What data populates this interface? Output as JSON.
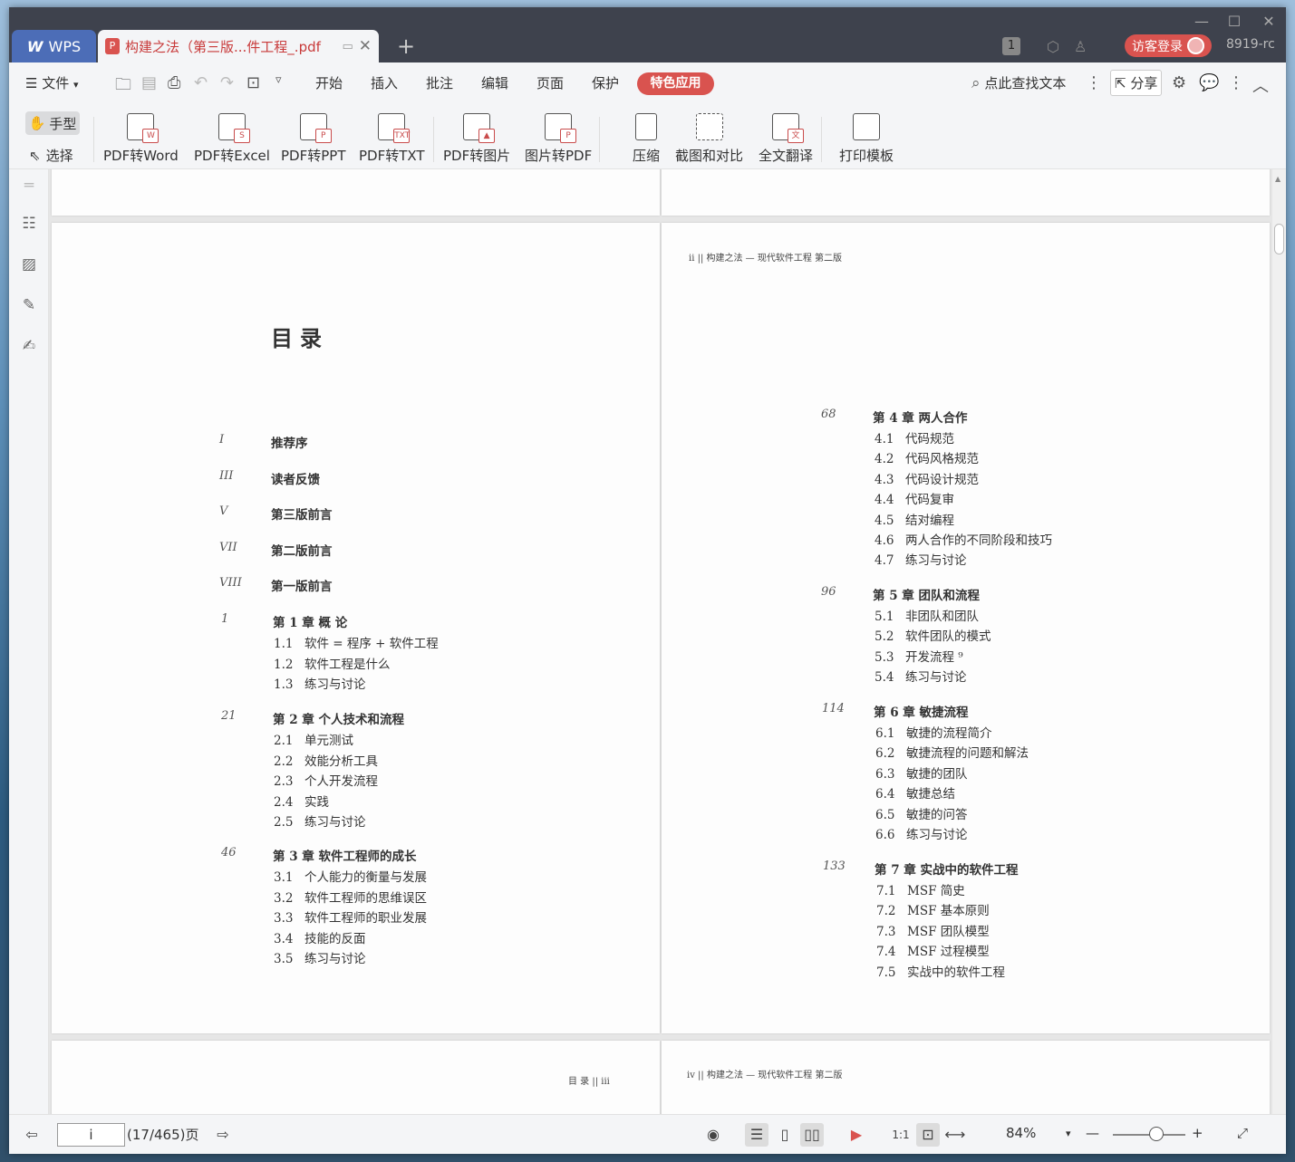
{
  "window": {
    "wps_tab": "WPS",
    "doc_tab": "构建之法（第三版...件工程_.pdf",
    "badge": "1",
    "login": "访客登录",
    "user_id": "8919-rc"
  },
  "menu": {
    "file": "文件",
    "items": [
      "开始",
      "插入",
      "批注",
      "编辑",
      "页面",
      "保护"
    ],
    "special": "特色应用",
    "search": "点此查找文本",
    "share": "分享"
  },
  "ribbon": {
    "hand": "手型",
    "select": "选择",
    "tools": [
      "PDF转Word",
      "PDF转Excel",
      "PDF转PPT",
      "PDF转TXT",
      "PDF转图片",
      "图片转PDF",
      "压缩",
      "截图和对比",
      "全文翻译",
      "打印模板"
    ]
  },
  "pages": {
    "right_header": "ii   ||     构建之法 — 现代软件工程   第二版",
    "left_title": "目录",
    "bottom_left_footer": "目   录      ||   iii",
    "bottom_right_header": "iv   ||     构建之法 — 现代软件工程   第二版",
    "left_front": [
      {
        "p": "I",
        "t": "推荐序"
      },
      {
        "p": "III",
        "t": "读者反馈"
      },
      {
        "p": "V",
        "t": "第三版前言"
      },
      {
        "p": "VII",
        "t": "第二版前言"
      },
      {
        "p": "VIII",
        "t": "第一版前言"
      }
    ],
    "left_chapters": [
      {
        "p": "1",
        "t": "第 1 章    概  论",
        "subs": [
          [
            "1.1",
            "软件 = 程序 + 软件工程"
          ],
          [
            "1.2",
            "软件工程是什么"
          ],
          [
            "1.3",
            "练习与讨论"
          ]
        ]
      },
      {
        "p": "21",
        "t": "第 2 章    个人技术和流程",
        "subs": [
          [
            "2.1",
            "单元测试"
          ],
          [
            "2.2",
            "效能分析工具"
          ],
          [
            "2.3",
            "个人开发流程"
          ],
          [
            "2.4",
            "实践"
          ],
          [
            "2.5",
            "练习与讨论"
          ]
        ]
      },
      {
        "p": "46",
        "t": "第 3 章    软件工程师的成长",
        "subs": [
          [
            "3.1",
            "个人能力的衡量与发展"
          ],
          [
            "3.2",
            "软件工程师的思维误区"
          ],
          [
            "3.3",
            "软件工程师的职业发展"
          ],
          [
            "3.4",
            "技能的反面"
          ],
          [
            "3.5",
            "练习与讨论"
          ]
        ]
      }
    ],
    "right_chapters": [
      {
        "p": "68",
        "t": "第 4 章    两人合作",
        "subs": [
          [
            "4.1",
            "代码规范"
          ],
          [
            "4.2",
            "代码风格规范"
          ],
          [
            "4.3",
            "代码设计规范"
          ],
          [
            "4.4",
            "代码复审"
          ],
          [
            "4.5",
            "结对编程"
          ],
          [
            "4.6",
            "两人合作的不同阶段和技巧"
          ],
          [
            "4.7",
            "练习与讨论"
          ]
        ]
      },
      {
        "p": "96",
        "t": "第 5 章    团队和流程",
        "subs": [
          [
            "5.1",
            "非团队和团队"
          ],
          [
            "5.2",
            "软件团队的模式"
          ],
          [
            "5.3",
            "开发流程 ⁹"
          ],
          [
            "5.4",
            "练习与讨论"
          ]
        ]
      },
      {
        "p": "114",
        "t": "第 6 章    敏捷流程",
        "subs": [
          [
            "6.1",
            "敏捷的流程简介"
          ],
          [
            "6.2",
            "敏捷流程的问题和解法"
          ],
          [
            "6.3",
            "敏捷的团队"
          ],
          [
            "6.4",
            "敏捷总结"
          ],
          [
            "6.5",
            "敏捷的问答"
          ],
          [
            "6.6",
            "练习与讨论"
          ]
        ]
      },
      {
        "p": "133",
        "t": "第 7 章    实战中的软件工程",
        "subs": [
          [
            "7.1",
            "MSF 简史"
          ],
          [
            "7.2",
            "MSF 基本原则"
          ],
          [
            "7.3",
            "MSF 团队模型"
          ],
          [
            "7.4",
            "MSF 过程模型"
          ],
          [
            "7.5",
            "实战中的软件工程"
          ]
        ]
      }
    ]
  },
  "status": {
    "page_input": "i",
    "page_count": "(17/465)页",
    "zoom": "84%",
    "zoom_fraction": 0.6
  },
  "colors": {
    "accent": "#d9534f",
    "wps_blue": "#4c6db7",
    "titlebar": "#3e424d"
  }
}
